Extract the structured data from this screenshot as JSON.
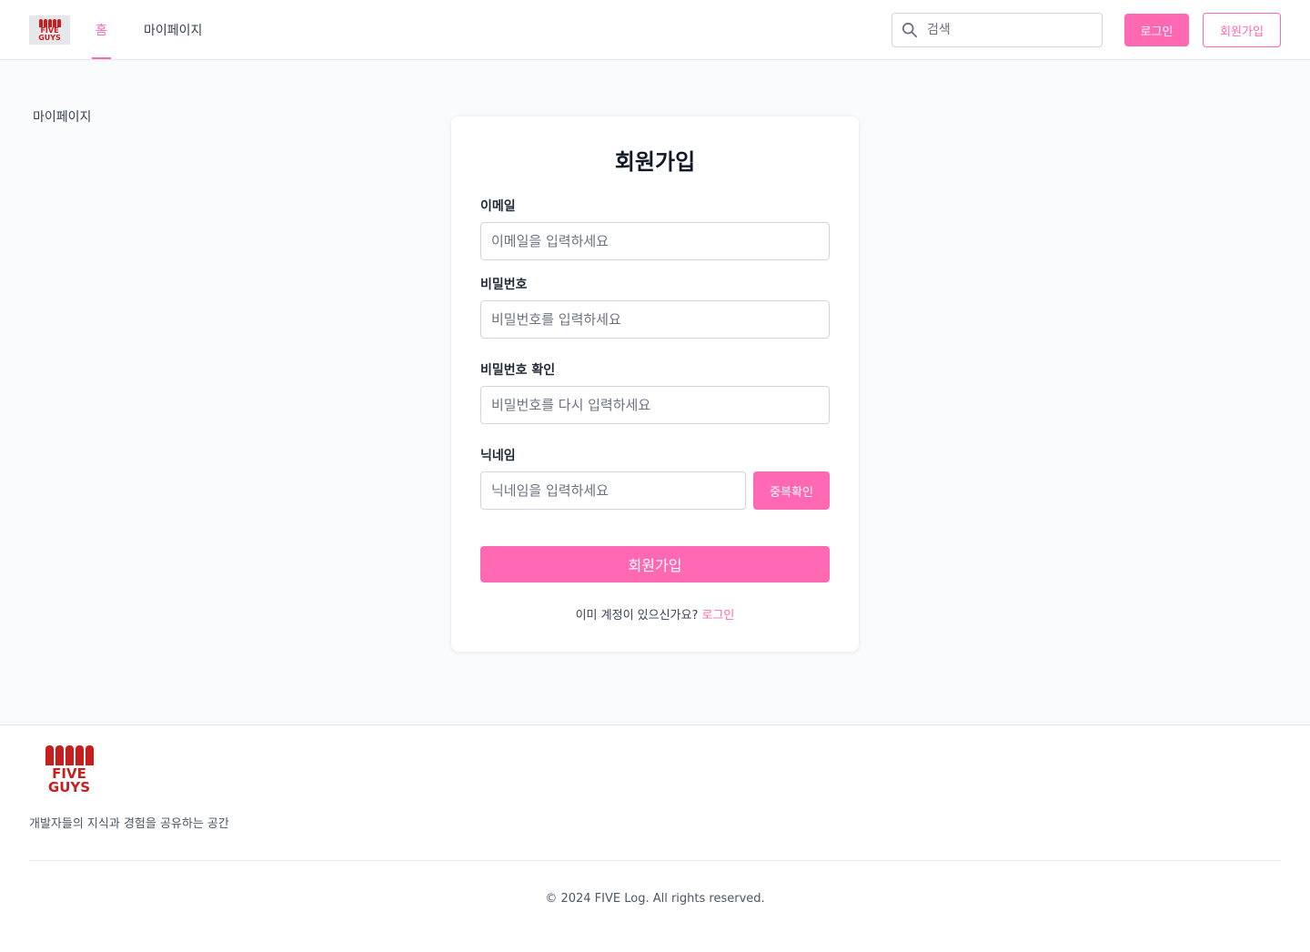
{
  "header": {
    "logo_text": "FIVE GUYS",
    "nav": {
      "home": "홈",
      "mypage": "마이페이지"
    },
    "search": {
      "placeholder": "검색",
      "value": ""
    },
    "login_label": "로그인",
    "signup_label": "회원가입"
  },
  "sidebar": {
    "mypage": "마이페이지"
  },
  "form": {
    "title": "회원가입",
    "email": {
      "label": "이메일",
      "placeholder": "이메일을 입력하세요"
    },
    "password": {
      "label": "비밀번호",
      "placeholder": "비밀번호를 입력하세요"
    },
    "password_confirm": {
      "label": "비밀번호 확인",
      "placeholder": "비밀번호를 다시 입력하세요"
    },
    "nickname": {
      "label": "닉네임",
      "placeholder": "닉네임을 입력하세요",
      "check_label": "중복확인"
    },
    "submit_label": "회원가입",
    "login_prompt": "이미 계정이 있으신가요?",
    "login_link": "로그인"
  },
  "footer": {
    "logo_text": "FIVE GUYS",
    "tagline": "개발자들의 지식과 경험을 공유하는 공간",
    "copyright": "© 2024 FIVE Log. All rights reserved."
  },
  "colors": {
    "accent": "#ff69b4",
    "logo_red": "#c81e1e",
    "background": "#f9fafb"
  }
}
